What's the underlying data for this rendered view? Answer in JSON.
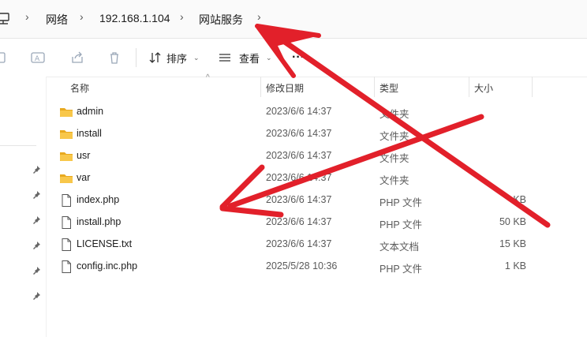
{
  "breadcrumb": {
    "items": [
      "网络",
      "192.168.1.104",
      "网站服务"
    ]
  },
  "toolbar": {
    "sort_label": "排序",
    "view_label": "查看",
    "more_label": "···"
  },
  "columns": {
    "name": "名称",
    "date": "修改日期",
    "type": "类型",
    "size": "大小"
  },
  "files": [
    {
      "name": "admin",
      "date": "2023/6/6 14:37",
      "type": "文件夹",
      "size": "",
      "icon": "folder-icon"
    },
    {
      "name": "install",
      "date": "2023/6/6 14:37",
      "type": "文件夹",
      "size": "",
      "icon": "folder-icon"
    },
    {
      "name": "usr",
      "date": "2023/6/6 14:37",
      "type": "文件夹",
      "size": "",
      "icon": "folder-icon"
    },
    {
      "name": "var",
      "date": "2023/6/6 14:37",
      "type": "文件夹",
      "size": "",
      "icon": "folder-icon"
    },
    {
      "name": "index.php",
      "date": "2023/6/6 14:37",
      "type": "PHP 文件",
      "size": "KB",
      "icon": "file-icon"
    },
    {
      "name": "install.php",
      "date": "2023/6/6 14:37",
      "type": "PHP 文件",
      "size": "50 KB",
      "icon": "file-icon"
    },
    {
      "name": "LICENSE.txt",
      "date": "2023/6/6 14:37",
      "type": "文本文档",
      "size": "15 KB",
      "icon": "file-icon"
    },
    {
      "name": "config.inc.php",
      "date": "2025/5/28 10:36",
      "type": "PHP 文件",
      "size": "1 KB",
      "icon": "file-icon"
    }
  ],
  "colors": {
    "folder": "#f8c74a",
    "folder_dark": "#e8a91f",
    "annotation_arrow": "#e2202a"
  }
}
